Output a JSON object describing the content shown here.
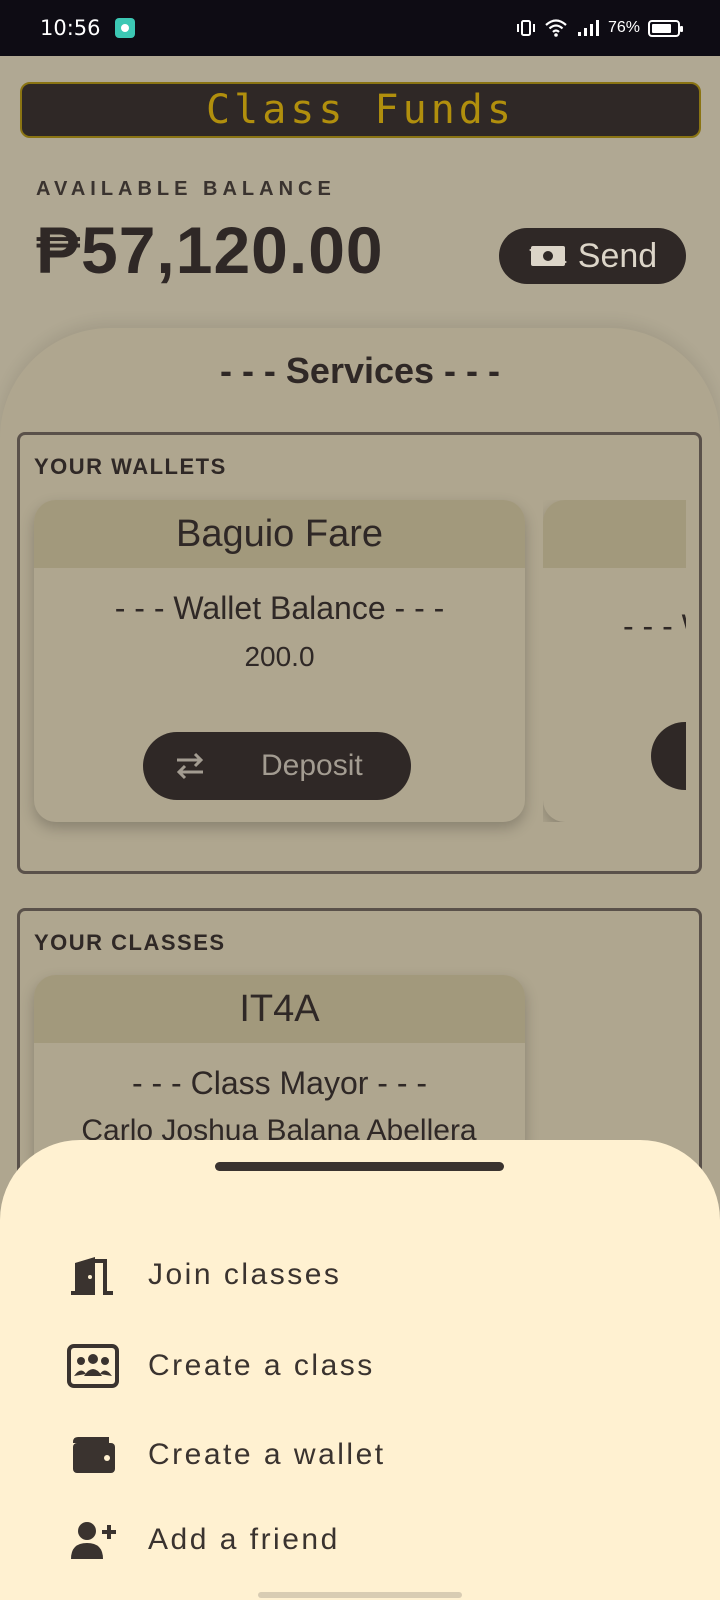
{
  "status": {
    "time": "10:56",
    "battery": "76%"
  },
  "app": {
    "title": "Class Funds"
  },
  "balance": {
    "label": "AVAILABLE BALANCE",
    "value": "₱57,120.00"
  },
  "send_button": {
    "label": "Send"
  },
  "services": {
    "title": "- - - Services - - -"
  },
  "wallets": {
    "section_label": "YOUR WALLETS",
    "cards": [
      {
        "name": "Baguio Fare",
        "subtitle": "- - - Wallet Balance - - -",
        "balance": "200.0",
        "button_label": "Deposit"
      },
      {
        "subtitle": "- - - W"
      }
    ]
  },
  "classes": {
    "section_label": "YOUR CLASSES",
    "cards": [
      {
        "name": "IT4A",
        "subtitle": "- - - Class Mayor - - -",
        "mayor": "Carlo Joshua Balana Abellera"
      }
    ]
  },
  "menu": {
    "items": [
      {
        "label": "Join classes",
        "icon": "door-icon"
      },
      {
        "label": "Create a class",
        "icon": "group-card-icon"
      },
      {
        "label": "Create a wallet",
        "icon": "wallet-icon"
      },
      {
        "label": "Add a friend",
        "icon": "person-add-icon"
      }
    ]
  },
  "colors": {
    "background": "#b0a893",
    "dark": "#2f2826",
    "gold": "#b18f0d",
    "sheet": "#fff1d1"
  }
}
